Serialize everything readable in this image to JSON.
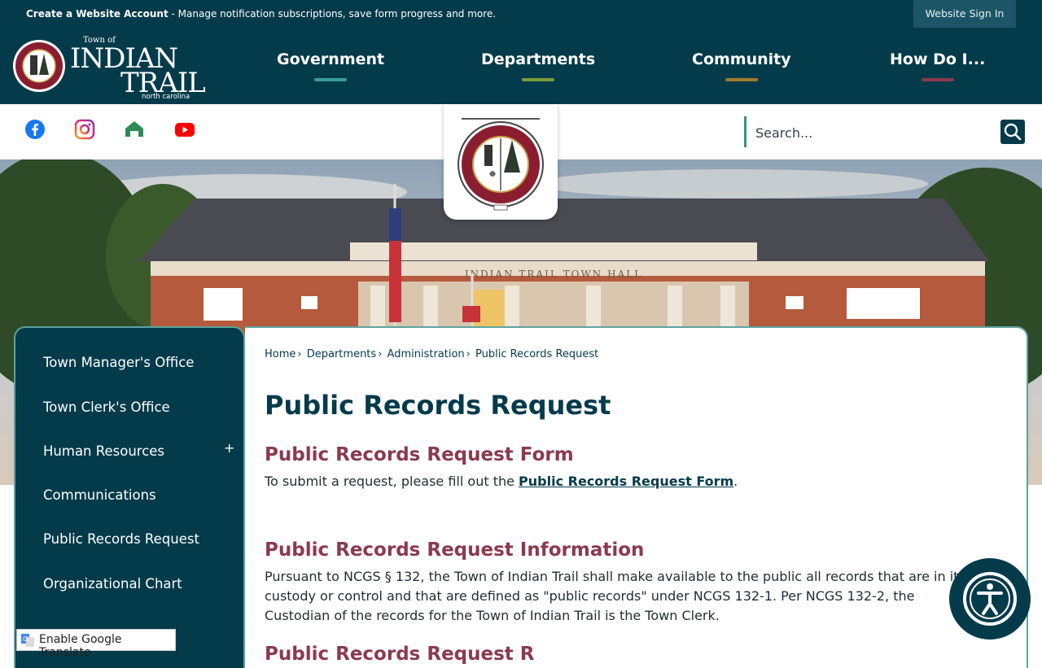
{
  "topbar": {
    "account_bold": "Create a Website Account",
    "account_rest": " - Manage notification subscriptions, save form progress and more.",
    "signin_label": "Website Sign In"
  },
  "logo": {
    "town_of": "Town of",
    "line1": "INDIAN",
    "line2": "TRAIL",
    "state": "north carolina"
  },
  "nav": [
    {
      "label": "Government",
      "accent": "#3a9c9a"
    },
    {
      "label": "Departments",
      "accent": "#7a9c3a"
    },
    {
      "label": "Community",
      "accent": "#a07a2e"
    },
    {
      "label": "How Do I...",
      "accent": "#8a3a4f"
    }
  ],
  "social": [
    "facebook-icon",
    "instagram-icon",
    "nextdoor-icon",
    "youtube-icon"
  ],
  "search": {
    "placeholder": "Search..."
  },
  "hero": {
    "building_sign": "INDIAN TRAIL TOWN HALL"
  },
  "sidebar": {
    "items": [
      {
        "label": "Town Manager's Office"
      },
      {
        "label": "Town Clerk's Office"
      },
      {
        "label": "Human Resources"
      },
      {
        "label": "Communications"
      },
      {
        "label": "Public Records Request"
      },
      {
        "label": "Organizational Chart"
      }
    ],
    "expand_symbol": "+"
  },
  "breadcrumb": {
    "items": [
      "Home",
      "Departments",
      "Administration",
      "Public Records Request"
    ],
    "separator": "›"
  },
  "main": {
    "title": "Public Records Request",
    "section1_heading": "Public Records Request Form",
    "section1_text_before": "To submit a request, please fill out the ",
    "section1_link": "Public Records Request Form",
    "section1_text_after": ".",
    "section2_heading": "Public Records Request Information",
    "section2_text": "Pursuant to NCGS § 132, the Town of Indian Trail shall make available to the public all records that are in its custody or control and that are defined as \"public records\" under NCGS 132-1. Per NCGS 132-2, the Custodian of the records for the Town of Indian Trail is the Town Clerk.",
    "section3_heading_partial": "Public Records Request R"
  },
  "translate": {
    "label": "Enable Google Translate"
  },
  "colors": {
    "brand": "#043b4b",
    "heading_accent": "#8a3a4f",
    "border_teal": "#5ea3a0"
  }
}
